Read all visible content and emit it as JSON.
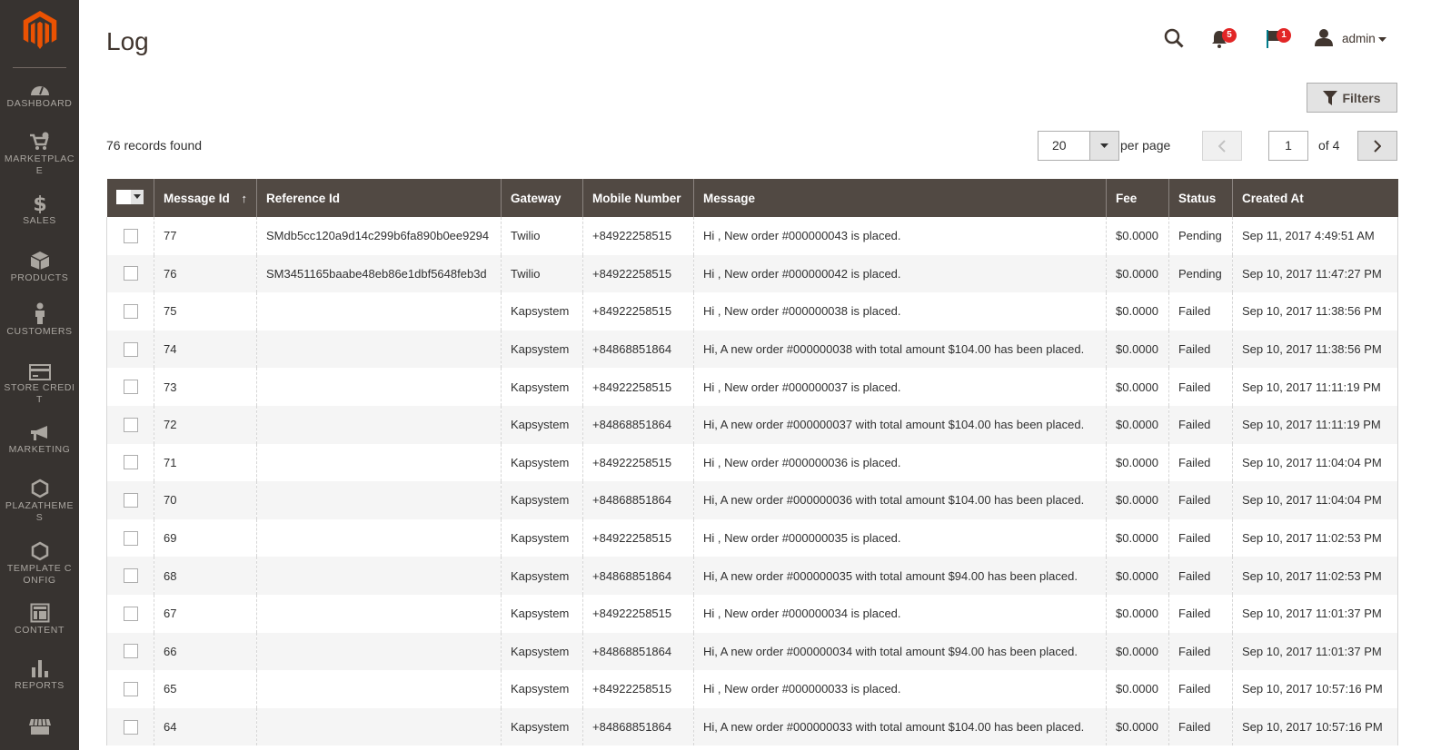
{
  "sidebar": {
    "logo": "magento-logo",
    "items": [
      {
        "label": "DASHBOARD",
        "icon": "dashboard-icon"
      },
      {
        "label": "MARKETPLACE",
        "icon": "cart-gear-icon"
      },
      {
        "label": "SALES",
        "icon": "dollar-icon"
      },
      {
        "label": "PRODUCTS",
        "icon": "box-icon"
      },
      {
        "label": "CUSTOMERS",
        "icon": "person-icon"
      },
      {
        "label": "STORE CREDIT",
        "icon": "credit-card-icon"
      },
      {
        "label": "MARKETING",
        "icon": "megaphone-icon"
      },
      {
        "label": "PLAZATHEMES",
        "icon": "hexagon-icon"
      },
      {
        "label": "TEMPLATE CONFIG",
        "icon": "hexagon-icon"
      },
      {
        "label": "CONTENT",
        "icon": "layout-icon"
      },
      {
        "label": "REPORTS",
        "icon": "bar-chart-icon"
      },
      {
        "label": "",
        "icon": "store-icon"
      }
    ]
  },
  "header": {
    "title": "Log",
    "notifications_count": "5",
    "system_messages_count": "1",
    "user": "admin"
  },
  "toolbar": {
    "filters_label": "Filters",
    "records_found": "76 records found",
    "per_page_value": "20",
    "per_page_label": "per page",
    "current_page": "1",
    "total_pages_label": "of 4"
  },
  "grid": {
    "columns": [
      "Message Id",
      "Reference Id",
      "Gateway",
      "Mobile Number",
      "Message",
      "Fee",
      "Status",
      "Created At"
    ],
    "sort_indicator": "↑",
    "rows": [
      {
        "id": "77",
        "ref": "SMdb5cc120a9d14c299b6fa890b0ee9294",
        "gateway": "Twilio",
        "mobile": "+84922258515",
        "message": "Hi , New order #000000043 is placed.",
        "fee": "$0.0000",
        "status": "Pending",
        "created": "Sep 11, 2017 4:49:51 AM"
      },
      {
        "id": "76",
        "ref": "SM3451165baabe48eb86e1dbf5648feb3d",
        "gateway": "Twilio",
        "mobile": "+84922258515",
        "message": "Hi , New order #000000042 is placed.",
        "fee": "$0.0000",
        "status": "Pending",
        "created": "Sep 10, 2017 11:47:27 PM"
      },
      {
        "id": "75",
        "ref": "",
        "gateway": "Kapsystem",
        "mobile": "+84922258515",
        "message": "Hi , New order #000000038 is placed.",
        "fee": "$0.0000",
        "status": "Failed",
        "created": "Sep 10, 2017 11:38:56 PM"
      },
      {
        "id": "74",
        "ref": "",
        "gateway": "Kapsystem",
        "mobile": "+84868851864",
        "message": "Hi, A new order #000000038 with total amount $104.00 has been placed.",
        "fee": "$0.0000",
        "status": "Failed",
        "created": "Sep 10, 2017 11:38:56 PM"
      },
      {
        "id": "73",
        "ref": "",
        "gateway": "Kapsystem",
        "mobile": "+84922258515",
        "message": "Hi , New order #000000037 is placed.",
        "fee": "$0.0000",
        "status": "Failed",
        "created": "Sep 10, 2017 11:11:19 PM"
      },
      {
        "id": "72",
        "ref": "",
        "gateway": "Kapsystem",
        "mobile": "+84868851864",
        "message": "Hi, A new order #000000037 with total amount $104.00 has been placed.",
        "fee": "$0.0000",
        "status": "Failed",
        "created": "Sep 10, 2017 11:11:19 PM"
      },
      {
        "id": "71",
        "ref": "",
        "gateway": "Kapsystem",
        "mobile": "+84922258515",
        "message": "Hi , New order #000000036 is placed.",
        "fee": "$0.0000",
        "status": "Failed",
        "created": "Sep 10, 2017 11:04:04 PM"
      },
      {
        "id": "70",
        "ref": "",
        "gateway": "Kapsystem",
        "mobile": "+84868851864",
        "message": "Hi, A new order #000000036 with total amount $104.00 has been placed.",
        "fee": "$0.0000",
        "status": "Failed",
        "created": "Sep 10, 2017 11:04:04 PM"
      },
      {
        "id": "69",
        "ref": "",
        "gateway": "Kapsystem",
        "mobile": "+84922258515",
        "message": "Hi , New order #000000035 is placed.",
        "fee": "$0.0000",
        "status": "Failed",
        "created": "Sep 10, 2017 11:02:53 PM"
      },
      {
        "id": "68",
        "ref": "",
        "gateway": "Kapsystem",
        "mobile": "+84868851864",
        "message": "Hi, A new order #000000035 with total amount $94.00 has been placed.",
        "fee": "$0.0000",
        "status": "Failed",
        "created": "Sep 10, 2017 11:02:53 PM"
      },
      {
        "id": "67",
        "ref": "",
        "gateway": "Kapsystem",
        "mobile": "+84922258515",
        "message": "Hi , New order #000000034 is placed.",
        "fee": "$0.0000",
        "status": "Failed",
        "created": "Sep 10, 2017 11:01:37 PM"
      },
      {
        "id": "66",
        "ref": "",
        "gateway": "Kapsystem",
        "mobile": "+84868851864",
        "message": "Hi, A new order #000000034 with total amount $94.00 has been placed.",
        "fee": "$0.0000",
        "status": "Failed",
        "created": "Sep 10, 2017 11:01:37 PM"
      },
      {
        "id": "65",
        "ref": "",
        "gateway": "Kapsystem",
        "mobile": "+84922258515",
        "message": "Hi , New order #000000033 is placed.",
        "fee": "$0.0000",
        "status": "Failed",
        "created": "Sep 10, 2017 10:57:16 PM"
      },
      {
        "id": "64",
        "ref": "",
        "gateway": "Kapsystem",
        "mobile": "+84868851864",
        "message": "Hi, A new order #000000033 with total amount $104.00 has been placed.",
        "fee": "$0.0000",
        "status": "Failed",
        "created": "Sep 10, 2017 10:57:16 PM"
      }
    ]
  },
  "colors": {
    "sidebar_bg": "#373330",
    "brand_orange": "#eb5202",
    "grid_header_bg": "#514943",
    "badge_red": "#e22626"
  }
}
